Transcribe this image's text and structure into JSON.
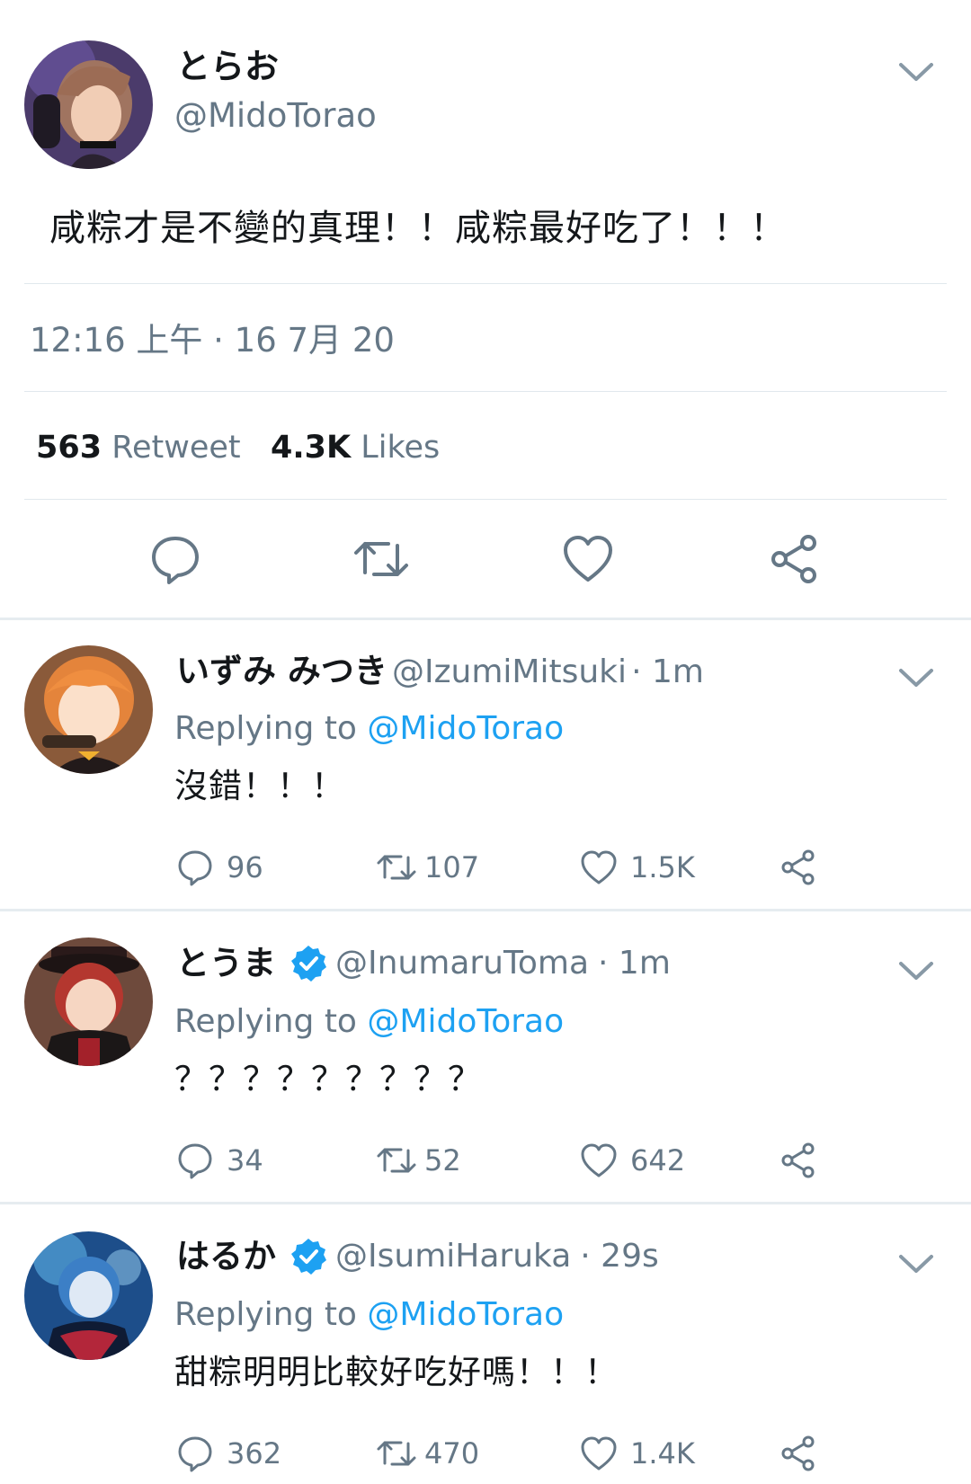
{
  "main_tweet": {
    "display_name": "とらお",
    "handle": "@MidoTorao",
    "text": "咸粽才是不變的真理！！咸粽最好吃了！！！",
    "timestamp": "12:16 上午 · 16 7月 20",
    "retweet_count": "563",
    "retweet_label": "Retweet",
    "like_count": "4.3K",
    "like_label": "Likes"
  },
  "replies": [
    {
      "display_name": "いずみ みつき",
      "handle": "@IzumiMitsuki",
      "time": "· 1m",
      "verified": false,
      "replying_prefix": "Replying to",
      "replying_to": "@MidoTorao",
      "text": "沒錯！！！",
      "comments": "96",
      "retweets": "107",
      "likes": "1.5K"
    },
    {
      "display_name": "とうま",
      "handle": "@InumaruToma",
      "time": "· 1m",
      "verified": true,
      "replying_prefix": "Replying to",
      "replying_to": "@MidoTorao",
      "text": "？？？？？？？？？",
      "comments": "34",
      "retweets": "52",
      "likes": "642"
    },
    {
      "display_name": "はるか",
      "handle": "@IsumiHaruka",
      "time": "· 29s",
      "verified": true,
      "replying_prefix": "Replying to",
      "replying_to": "@MidoTorao",
      "text": "甜粽明明比較好吃好嗎！！！",
      "comments": "362",
      "retweets": "470",
      "likes": "1.4K"
    }
  ],
  "colors": {
    "text": "#14171a",
    "secondary": "#657786",
    "link": "#1da1f2",
    "divider": "#e1e8ed"
  },
  "icons": [
    "chevron-down-icon",
    "comment-icon",
    "retweet-icon",
    "like-icon",
    "share-icon",
    "verified-badge-icon"
  ]
}
